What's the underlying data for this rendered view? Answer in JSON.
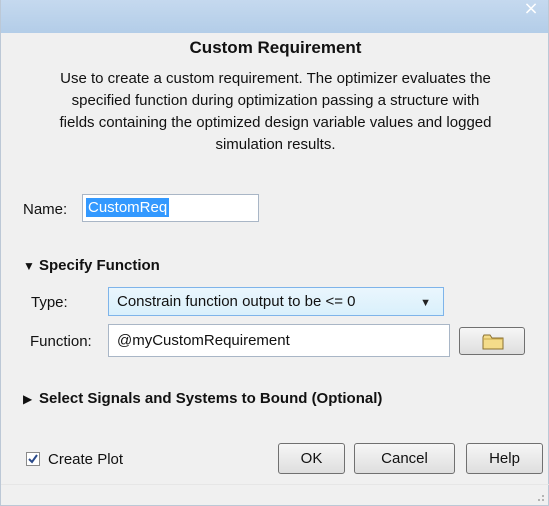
{
  "window": {
    "close_label": "×"
  },
  "dialog": {
    "title": "Custom Requirement",
    "description_lines": [
      "Use to create a custom requirement. The optimizer evaluates the",
      "specified function during optimization passing a structure with",
      "fields containing the optimized design variable values and logged",
      "simulation results."
    ]
  },
  "name": {
    "label": "Name:",
    "value": "CustomReq"
  },
  "specify_function": {
    "header": "Specify Function",
    "expanded": true,
    "type_label": "Type:",
    "type_value": "Constrain function output to be <= 0",
    "function_label": "Function:",
    "function_value": "@myCustomRequirement",
    "browse_icon": "folder-icon"
  },
  "signals_section": {
    "header": "Select Signals and Systems to Bound (Optional)",
    "expanded": false
  },
  "footer": {
    "create_plot_label": "Create Plot",
    "create_plot_checked": true,
    "ok_label": "OK",
    "cancel_label": "Cancel",
    "help_label": "Help"
  },
  "colors": {
    "titlebar": "#b9d1ea",
    "dialog_bg": "#f0f0f0",
    "selection": "#3399ff",
    "dropdown_hover": "#d9f0fc"
  }
}
